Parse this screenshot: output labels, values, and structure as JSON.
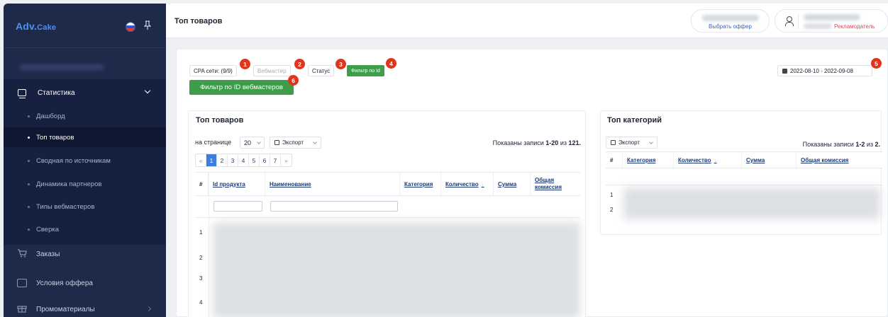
{
  "sidebar": {
    "brand_main": "Adv.",
    "brand_small": "Cake",
    "section_label": "Статистика",
    "subitems": [
      "Дашборд",
      "Топ товаров",
      "Сводная по источникам",
      "Динамика партнеров",
      "Типы вебмастеров",
      "Сверка"
    ],
    "active_subitem": "Топ товаров",
    "items": [
      "Заказы",
      "Условия оффера",
      "Промоматериалы"
    ]
  },
  "header": {
    "title": "Топ товаров",
    "offer_label": "Выбрать оффер",
    "role_label": "Рекламодатель"
  },
  "filters": {
    "cpa_label": "CPA сети: (9/9)",
    "webmaster_label": "Вебмастер",
    "status_label": "Статус",
    "filter_id_label": "Фильтр по Id",
    "filter_webmaster_id_label": "Фильтр по ID вебмастеров",
    "date_range": "2022-08-10 - 2022-09-08",
    "badges": [
      "1",
      "2",
      "3",
      "4",
      "5",
      "6"
    ]
  },
  "products": {
    "title": "Топ товаров",
    "perpage_label": "на странице",
    "perpage_value": "20",
    "export_label": "Экспорт",
    "shown_prefix": "Показаны записи ",
    "shown_range": "1-20",
    "shown_mid": " из ",
    "shown_total": "121.",
    "pager": [
      "«",
      "1",
      "2",
      "3",
      "4",
      "5",
      "6",
      "7",
      "»"
    ],
    "active_page": "1",
    "columns": [
      "#",
      "Id продукта",
      "Наименование",
      "Категория",
      "Количество",
      "Сумма",
      "Общая комиссия"
    ],
    "rows": [
      "1",
      "2",
      "3",
      "4"
    ]
  },
  "categories": {
    "title": "Топ категорий",
    "export_label": "Экспорт",
    "shown_prefix": "Показаны записи ",
    "shown_range": "1-2",
    "shown_mid": " из ",
    "shown_total": "2.",
    "columns": [
      "#",
      "Категория",
      "Количество",
      "Сумма",
      "Общая комиссия"
    ],
    "rows": [
      "1",
      "2"
    ]
  },
  "colors": {
    "sidebar": "#1e2a4a",
    "accent_green": "#3f9c4a",
    "badge_red": "#e0351d",
    "pager_active": "#3d7de0"
  }
}
